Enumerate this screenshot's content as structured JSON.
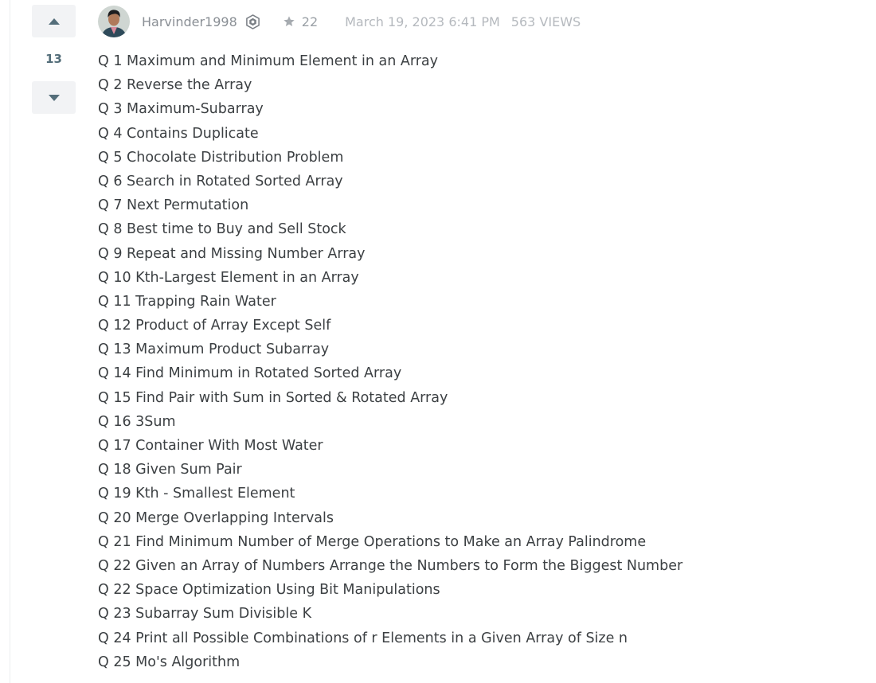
{
  "vote": {
    "count": "13"
  },
  "post": {
    "username": "Harvinder1998",
    "reputation": "22",
    "date": "March 19, 2023 6:41 PM",
    "views": "563 VIEWS"
  },
  "questions": [
    "Q 1 Maximum and Minimum Element in an Array",
    "Q 2 Reverse the Array",
    "Q 3 Maximum-Subarray",
    "Q 4 Contains Duplicate",
    "Q 5 Chocolate Distribution Problem",
    "Q 6 Search in Rotated Sorted Array",
    "Q 7 Next Permutation",
    "Q 8 Best time to Buy and Sell Stock",
    "Q 9 Repeat and Missing Number Array",
    "Q 10 Kth-Largest Element in an Array",
    "Q 11 Trapping Rain Water",
    "Q 12 Product of Array Except Self",
    "Q 13 Maximum Product Subarray",
    "Q 14 Find Minimum in Rotated Sorted Array",
    "Q 15 Find Pair with Sum in Sorted & Rotated Array",
    "Q 16 3Sum",
    "Q 17 Container With Most Water",
    "Q 18 Given Sum Pair",
    "Q 19 Kth - Smallest Element",
    "Q 20 Merge Overlapping Intervals",
    "Q 21 Find Minimum Number of Merge Operations to Make an Array Palindrome",
    "Q 22 Given an Array of Numbers Arrange the Numbers to Form the Biggest Number",
    "Q 22 Space Optimization Using Bit Manipulations",
    "Q 23 Subarray Sum Divisible K",
    "Q 24 Print all Possible Combinations of r Elements in a Given Array of Size n",
    "Q 25 Mo's Algorithm"
  ],
  "colors": {
    "vote_bg": "#f2f3f5",
    "vote_arrow": "#546e7a",
    "muted_text": "#8a8f95",
    "body_text": "#3c4043"
  }
}
